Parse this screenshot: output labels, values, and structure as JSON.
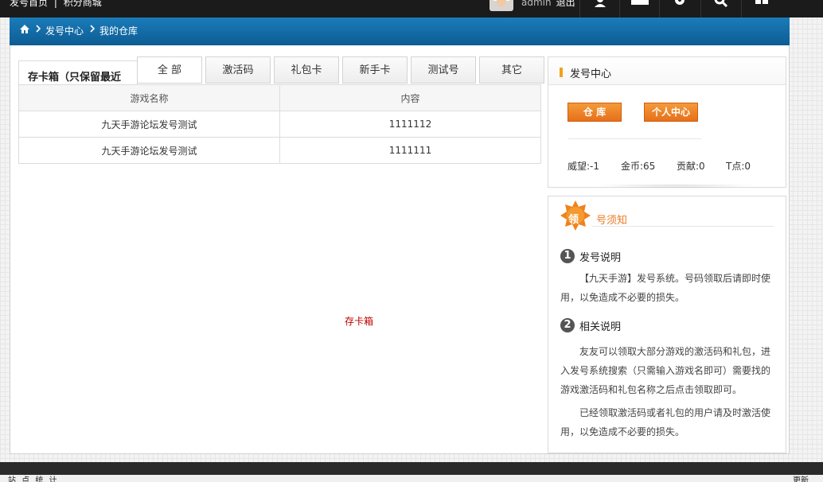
{
  "topbar": {
    "site_links": [
      "发号首页",
      "|",
      "积分商城"
    ],
    "username": "admin",
    "logout": "退出",
    "tools": [
      "user-icon",
      "mail-icon",
      "gear-icon",
      "search-icon",
      "grid-icon"
    ]
  },
  "breadcrumb": {
    "items": [
      "发号中心",
      "我的仓库"
    ]
  },
  "cardbox": {
    "title": "存卡箱（只保留最近",
    "tabs": [
      "全 部",
      "激活码",
      "礼包卡",
      "新手卡",
      "测试号",
      "其它"
    ],
    "columns": [
      "游戏名称",
      "内容"
    ],
    "rows": [
      {
        "game": "九天手游论坛发号测试",
        "content": "1111112"
      },
      {
        "game": "九天手游论坛发号测试",
        "content": "1111111"
      }
    ],
    "empty_label": "存卡箱"
  },
  "center_panel": {
    "title": "发号中心",
    "buttons": {
      "warehouse": "仓 库",
      "personal": "个人中心"
    },
    "stats": {
      "prestige": "威望:-1",
      "gold": "金币:65",
      "contribution": "贡献:0",
      "tpoints": "T点:0"
    }
  },
  "notice_panel": {
    "badge": "领",
    "title": "号须知",
    "sections": [
      {
        "num": "1",
        "title": "发号说明",
        "paragraphs": [
          "【九天手游】发号系统。号码领取后请即时使用，以免造成不必要的损失。"
        ]
      },
      {
        "num": "2",
        "title": "相关说明",
        "paragraphs": [
          "友友可以领取大部分游戏的激活码和礼包，进入发号系统搜索（只需输入游戏名即可）需要找的游戏激活码和礼包名称之后点击领取即可。",
          "已经领取激活码或者礼包的用户请及时激活使用，以免造成不必要的损失。"
        ]
      }
    ]
  },
  "footer": {
    "left": "站 点 统 计",
    "right": "更新"
  },
  "colors": {
    "accent_orange": "#ec7a22",
    "breadcrumb_blue": "#0d5c93",
    "empty_red": "#c00000"
  }
}
